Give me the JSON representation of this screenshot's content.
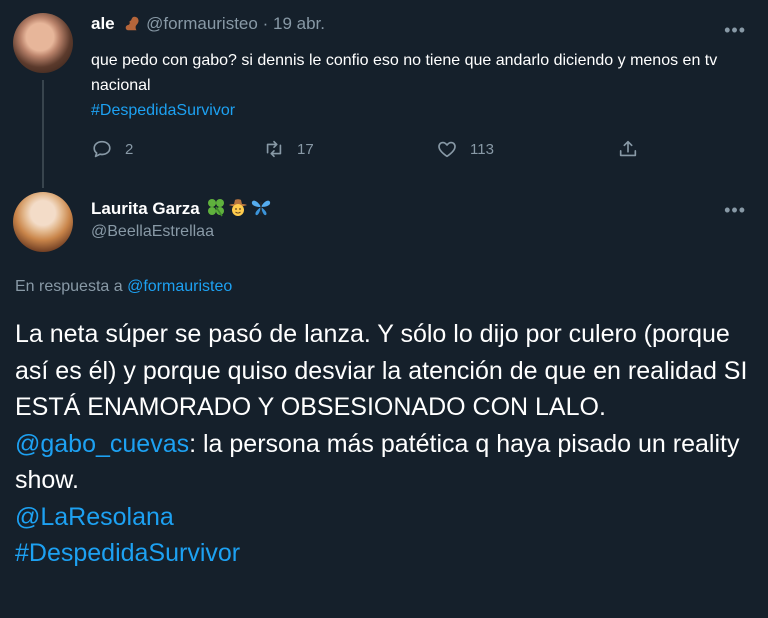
{
  "reply_parent": {
    "display_name": "ale",
    "handle": "@formauristeo",
    "separator": "·",
    "date": "19 abr.",
    "text": "que pedo con gabo? si dennis le confio eso no tiene que andarlo diciendo y menos en tv nacional",
    "hashtag": "#DespedidaSurvivor",
    "more_icon": "more-icon",
    "actions": {
      "reply_count": "2",
      "retweet_count": "17",
      "like_count": "113"
    }
  },
  "main_tweet": {
    "display_name": "Laurita Garza",
    "name_emojis": [
      "four-leaf-clover",
      "cowboy-face",
      "butterfly"
    ],
    "handle": "@BeellaEstrellaa",
    "reply_prefix": "En respuesta a",
    "reply_mention": "@formauristeo",
    "body_line1": "La neta súper se pasó de lanza. Y sólo lo dijo por culero (porque así es él) y porque quiso desviar la atención de que en realidad SI ESTÁ ENAMORADO Y OBSESIONADO CON LALO.",
    "mention1": "@gabo_cuevas",
    "body_line2": ": la persona más patética q haya pisado un reality show.",
    "mention2": "@LaResolana",
    "hashtag": "#DespedidaSurvivor"
  },
  "colors": {
    "background": "#15202b",
    "text": "#ffffff",
    "muted": "#8899a6",
    "accent": "#1da1f2",
    "divider": "#38444d"
  }
}
